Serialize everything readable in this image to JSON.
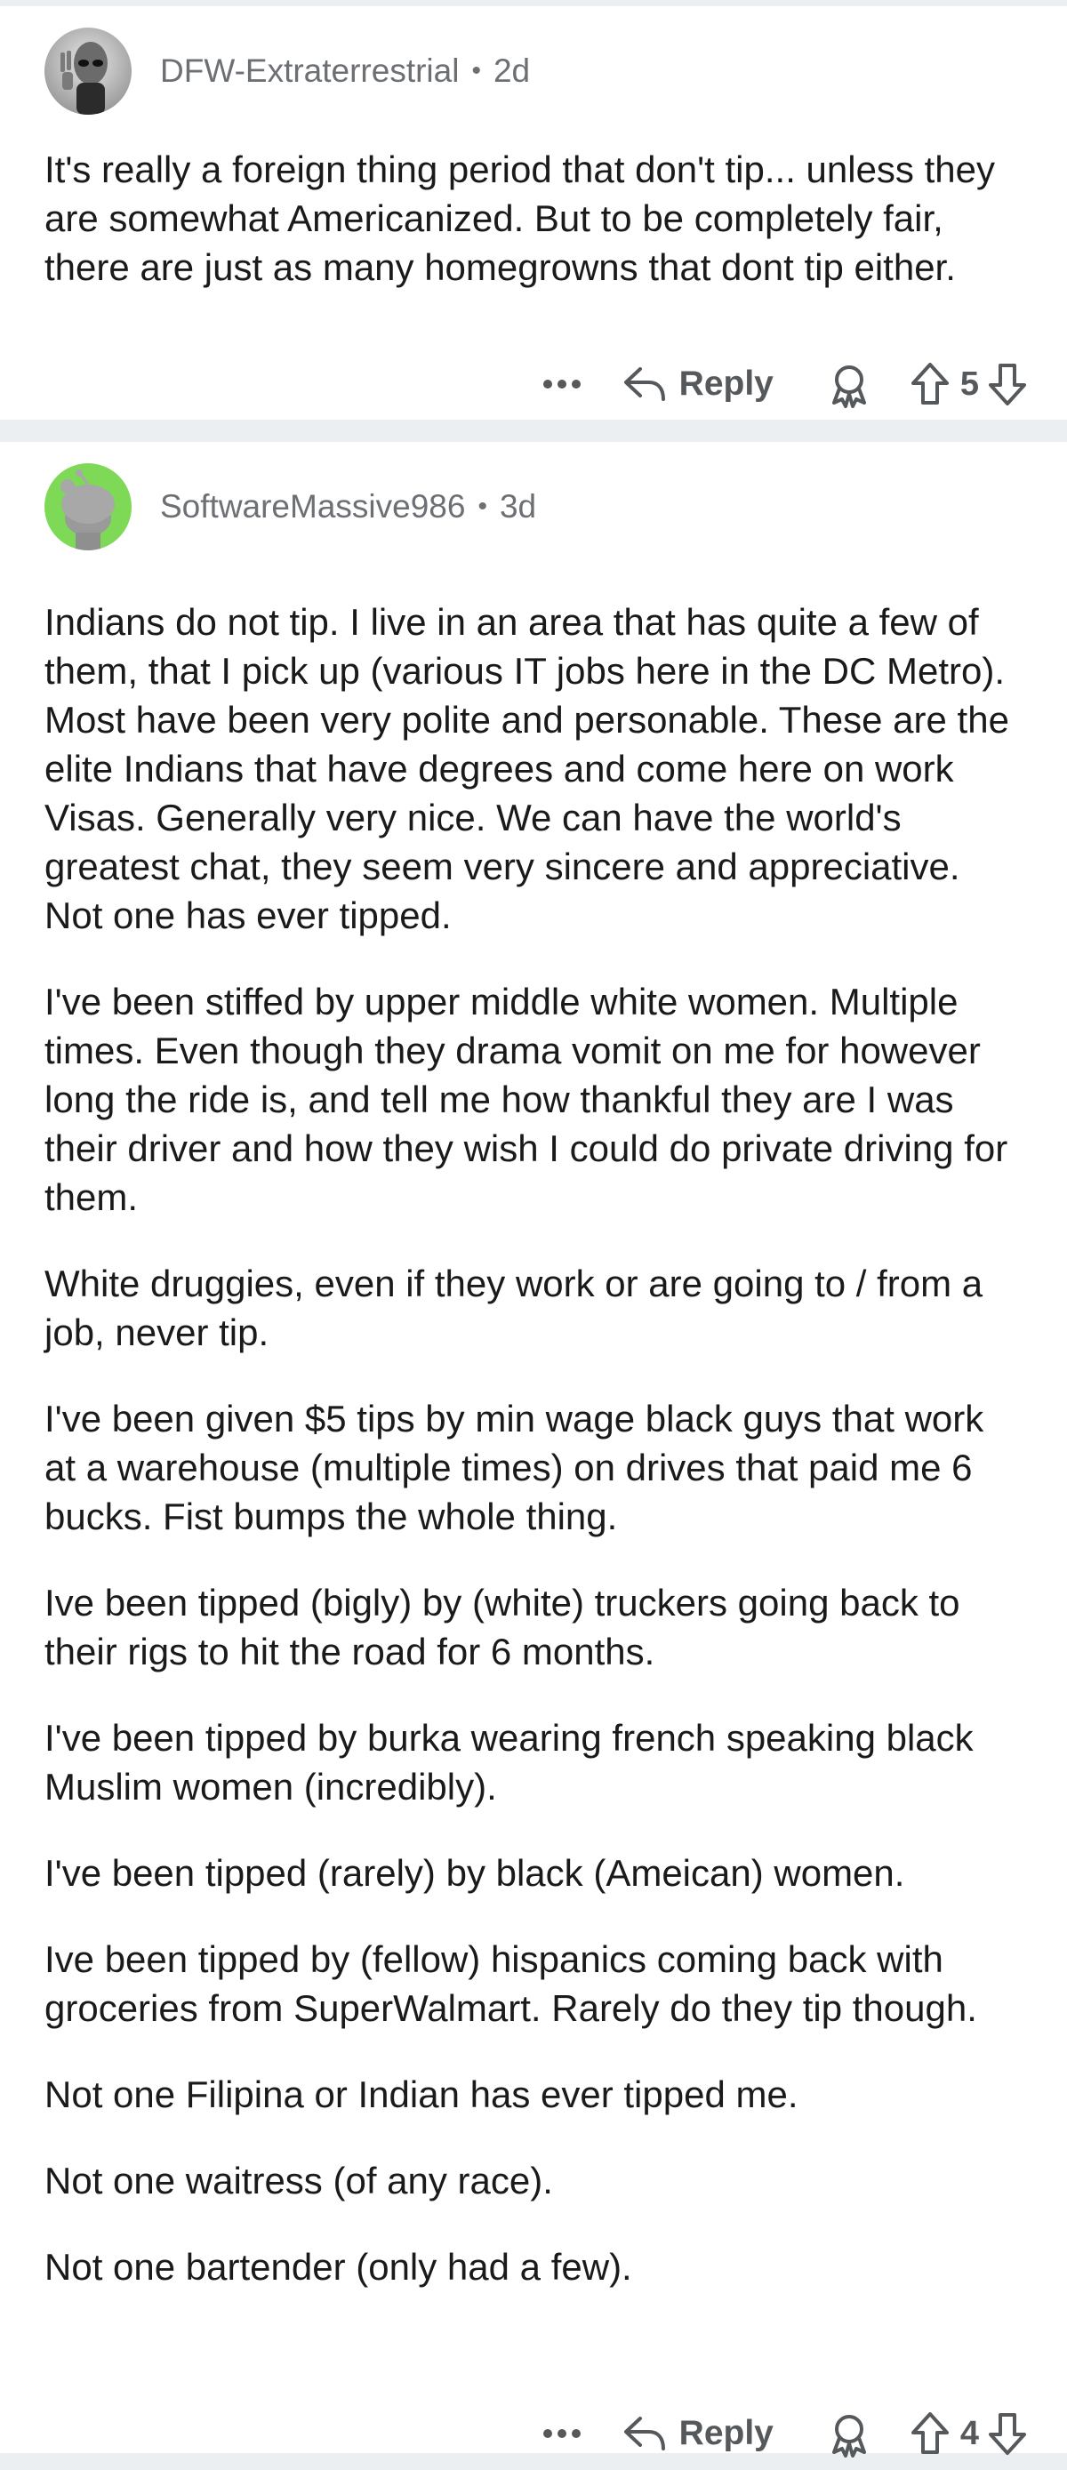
{
  "comments": [
    {
      "username": "DFW-Extraterrestrial",
      "separator": "•",
      "age": "2d",
      "avatar_icon": "alien-avatar-icon",
      "paragraphs": [
        "It's really a foreign thing period that don't tip... unless they are somewhat Americanized. But to be completely fair, there are just as many homegrowns that dont tip either."
      ],
      "more_icon": "more-options-icon",
      "reply_label": "Reply",
      "vote_count": "5"
    },
    {
      "username": "SoftwareMassive986",
      "separator": "•",
      "age": "3d",
      "avatar_icon": "snoo-avatar-icon",
      "avatar_color": "#7ed957",
      "paragraphs": [
        "Indians do not tip.  I live in an area that has quite a few of them, that I pick up (various IT jobs here in the DC Metro). Most have been very polite and personable. These are the elite Indians that have degrees and come here on work Visas. Generally very nice. We can have the world's greatest chat, they seem very sincere and appreciative. Not one has ever tipped.",
        "I've been stiffed by upper middle white women. Multiple times. Even though they drama vomit on me for however long the ride is, and tell me how thankful they are I was their driver and how they wish I could do private driving for them.",
        "White druggies, even if they work or are going to / from a job, never tip.",
        "I've been given $5 tips by min wage black guys that work at a warehouse (multiple times) on drives that paid me 6 bucks. Fist bumps the whole thing.",
        "Ive been tipped (bigly) by (white) truckers going back to their rigs to hit the road for 6 months.",
        "I've been tipped by burka wearing french speaking black Muslim women (incredibly).",
        "I've been tipped (rarely) by black (Ameican) women.",
        "Ive been tipped by (fellow) hispanics coming back with groceries from SuperWalmart.  Rarely do they tip though.",
        "Not one Filipina or Indian has ever tipped me.",
        "Not one waitress (of any race).",
        "Not one bartender (only had a few)."
      ],
      "more_icon": "more-options-icon",
      "reply_label": "Reply",
      "vote_count": "4"
    }
  ],
  "colors": {
    "background": "#eceff1",
    "card": "#ffffff",
    "meta_text": "#6c7074",
    "body_text": "#1a1a1b"
  }
}
